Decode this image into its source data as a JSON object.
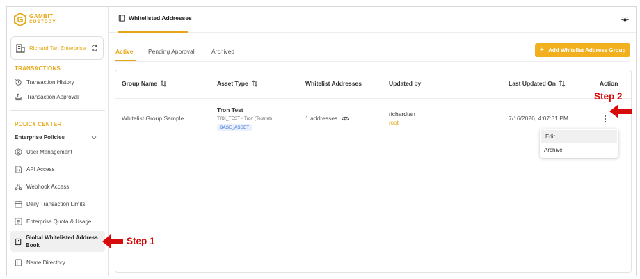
{
  "brand": {
    "name": "GAMBIT",
    "sub": "CUSTODY",
    "accent": "#e6a817"
  },
  "enterprise": {
    "name": "Richard Tan Enterprise",
    "icon": "building-icon",
    "switch_icon": "switch-icon"
  },
  "sidebar": {
    "sections": [
      {
        "label": "TRANSACTIONS"
      },
      {
        "label": "POLICY CENTER"
      }
    ],
    "transactions": [
      {
        "label": "Transaction History",
        "icon": "history-icon"
      },
      {
        "label": "Transaction Approval",
        "icon": "approval-icon"
      }
    ],
    "group_label": "Enterprise Policies",
    "policies": [
      {
        "label": "User Management",
        "icon": "users-icon"
      },
      {
        "label": "API Access",
        "icon": "api-icon"
      },
      {
        "label": "Webhook Access",
        "icon": "webhook-icon"
      },
      {
        "label": "Daily Transaction Limits",
        "icon": "calendar-icon"
      },
      {
        "label": "Enterprise Quota & Usage",
        "icon": "quota-icon"
      }
    ],
    "active_item": {
      "label": "Global Whitelisted Address Book",
      "icon": "address-book-icon"
    },
    "last_item": {
      "label": "Name Directory",
      "icon": "directory-icon"
    }
  },
  "header": {
    "page_tab": "Whitelisted Addresses",
    "theme_icon": "sun-icon"
  },
  "tabs": [
    {
      "label": "Active",
      "active": true
    },
    {
      "label": "Pending Approval",
      "active": false
    },
    {
      "label": "Archived",
      "active": false
    }
  ],
  "add_button": {
    "label": "Add Whitelist Address Group",
    "icon": "plus-icon"
  },
  "table": {
    "columns": [
      {
        "label": "Group Name",
        "sortable": true
      },
      {
        "label": "Asset Type",
        "sortable": true
      },
      {
        "label": "Whitelist Addresses",
        "sortable": false
      },
      {
        "label": "Updated by",
        "sortable": false
      },
      {
        "label": "Last Updated On",
        "sortable": true
      },
      {
        "label": "Action",
        "sortable": false
      }
    ],
    "rows": [
      {
        "group_name": "Whitelist Group Sample",
        "asset_name": "Tron Test",
        "asset_detail": "TRX_TEST • Tron (Testnet)",
        "asset_badge": "BASE_ASSET",
        "addresses": "1 addresses",
        "updated_by": "richardtan",
        "updated_role": "root",
        "updated_on": "7/16/2026, 4:07:31 PM"
      }
    ]
  },
  "action_menu": [
    {
      "label": "Edit"
    },
    {
      "label": "Archive"
    }
  ],
  "annotations": [
    {
      "label": "Step 1",
      "color": "#d80b0b"
    },
    {
      "label": "Step 2",
      "color": "#d80b0b"
    }
  ]
}
